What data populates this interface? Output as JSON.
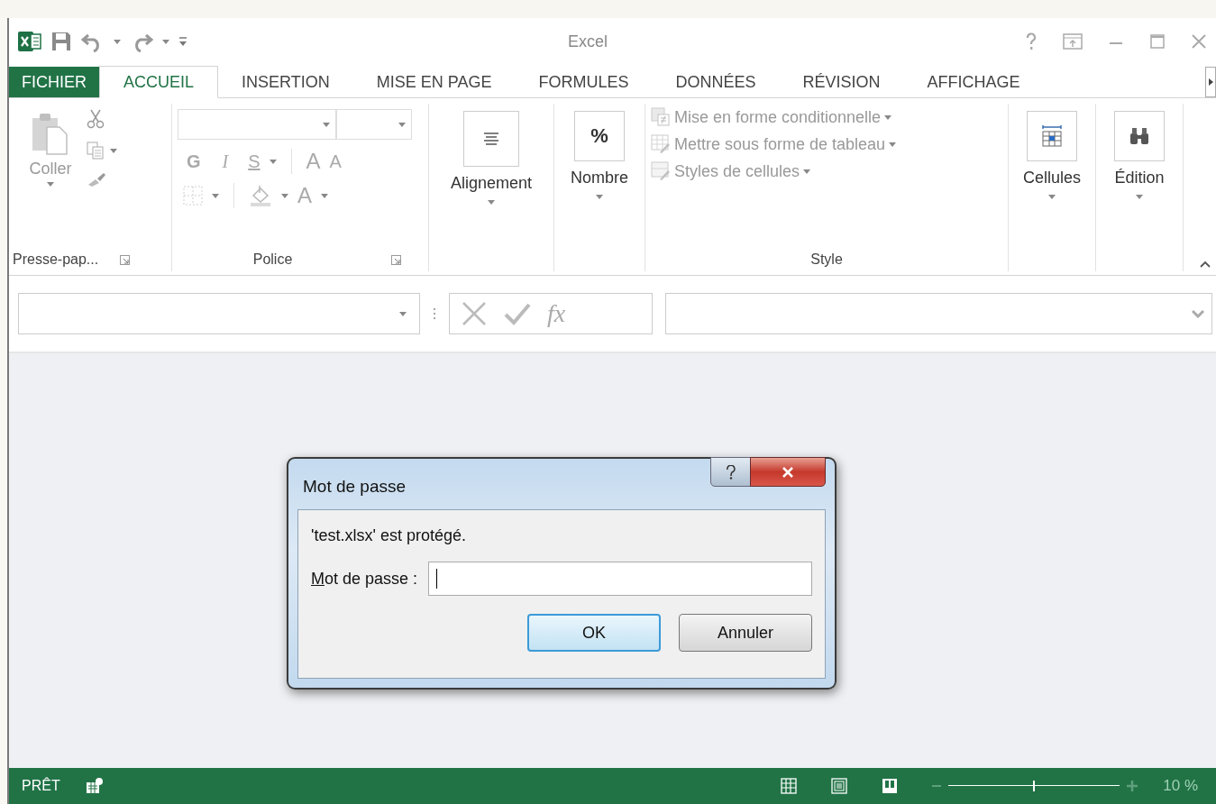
{
  "window": {
    "title": "Excel"
  },
  "tabs": [
    {
      "label": "FICHIER",
      "kind": "file",
      "selected": false
    },
    {
      "label": "ACCUEIL",
      "kind": "tab",
      "selected": true
    },
    {
      "label": "INSERTION",
      "kind": "tab",
      "selected": false
    },
    {
      "label": "MISE EN PAGE",
      "kind": "tab",
      "selected": false
    },
    {
      "label": "FORMULES",
      "kind": "tab",
      "selected": false
    },
    {
      "label": "DONNÉES",
      "kind": "tab",
      "selected": false
    },
    {
      "label": "RÉVISION",
      "kind": "tab",
      "selected": false
    },
    {
      "label": "AFFICHAGE",
      "kind": "tab",
      "selected": false
    }
  ],
  "ribbon": {
    "groups": [
      {
        "kind": "clipboard",
        "label": "Presse-pap...",
        "paste": "Coller",
        "disabled": true
      },
      {
        "kind": "font",
        "label": "Police",
        "bold": "G",
        "italic": "I",
        "underline": "S",
        "grow": "A",
        "shrink": "A",
        "font_color": "A",
        "disabled": true
      },
      {
        "kind": "alignment",
        "button": "Alignement",
        "disabled": false
      },
      {
        "kind": "number",
        "button": "Nombre",
        "glyph": "%",
        "disabled": false
      },
      {
        "kind": "style",
        "label": "Style",
        "items": [
          {
            "label": "Mise en forme conditionnelle",
            "disabled": true
          },
          {
            "label": "Mettre sous forme de tableau",
            "disabled": true
          },
          {
            "label": "Styles de cellules",
            "disabled": true
          }
        ]
      },
      {
        "kind": "cells",
        "button": "Cellules",
        "disabled": false
      },
      {
        "kind": "editing",
        "button": "Édition",
        "disabled": false
      }
    ]
  },
  "formula_bar": {
    "fx": "fx"
  },
  "dialog": {
    "title": "Mot de passe",
    "message": "'test.xlsx' est protégé.",
    "field_label": "Mot de passe :",
    "buttons": [
      {
        "label": "OK",
        "default": true
      },
      {
        "label": "Annuler",
        "default": false
      }
    ]
  },
  "status_bar": {
    "status": "PRÊT",
    "zoom": "10 %",
    "level": 0.5
  }
}
